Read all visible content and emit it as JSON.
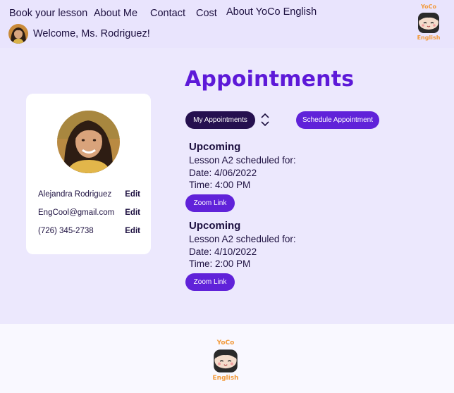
{
  "nav": {
    "items": [
      {
        "label": "Book your lesson"
      },
      {
        "label": "About Me"
      },
      {
        "label": "Contact"
      },
      {
        "label": "Cost"
      },
      {
        "label": "About YoCo English"
      }
    ],
    "welcome": "Welcome, Ms. Rodriguez!"
  },
  "logo": {
    "top_text": "YoCo",
    "bottom_text": "English"
  },
  "profile": {
    "name": "Alejandra Rodriguez",
    "email": "EngCool@gmail.com",
    "phone": "(726) 345-2738",
    "edit_label": "Edit"
  },
  "page": {
    "title": "Appointments",
    "my_appointments_label": "My Appointments",
    "schedule_label": "Schedule Appointment"
  },
  "appointments": [
    {
      "status": "Upcoming",
      "lesson": "Lesson A2 scheduled for:",
      "date": "Date: 4/06/2022",
      "time": "Time: 4:00 PM",
      "link_label": "Zoom Link"
    },
    {
      "status": "Upcoming",
      "lesson": "Lesson A2 scheduled for:",
      "date": "Date: 4/10/2022",
      "time": "Time: 2:00 PM",
      "link_label": "Zoom Link"
    }
  ],
  "colors": {
    "header_bg": "#e9e4fd",
    "main_bg": "#ece8fd",
    "accent_purple": "#6022d9",
    "dark_pill": "#25104f",
    "title_purple": "#5d19d8",
    "logo_orange": "#f29a3b"
  },
  "icons": {
    "sort": "sort-updown-icon",
    "logo_face": "yoco-face-icon"
  }
}
